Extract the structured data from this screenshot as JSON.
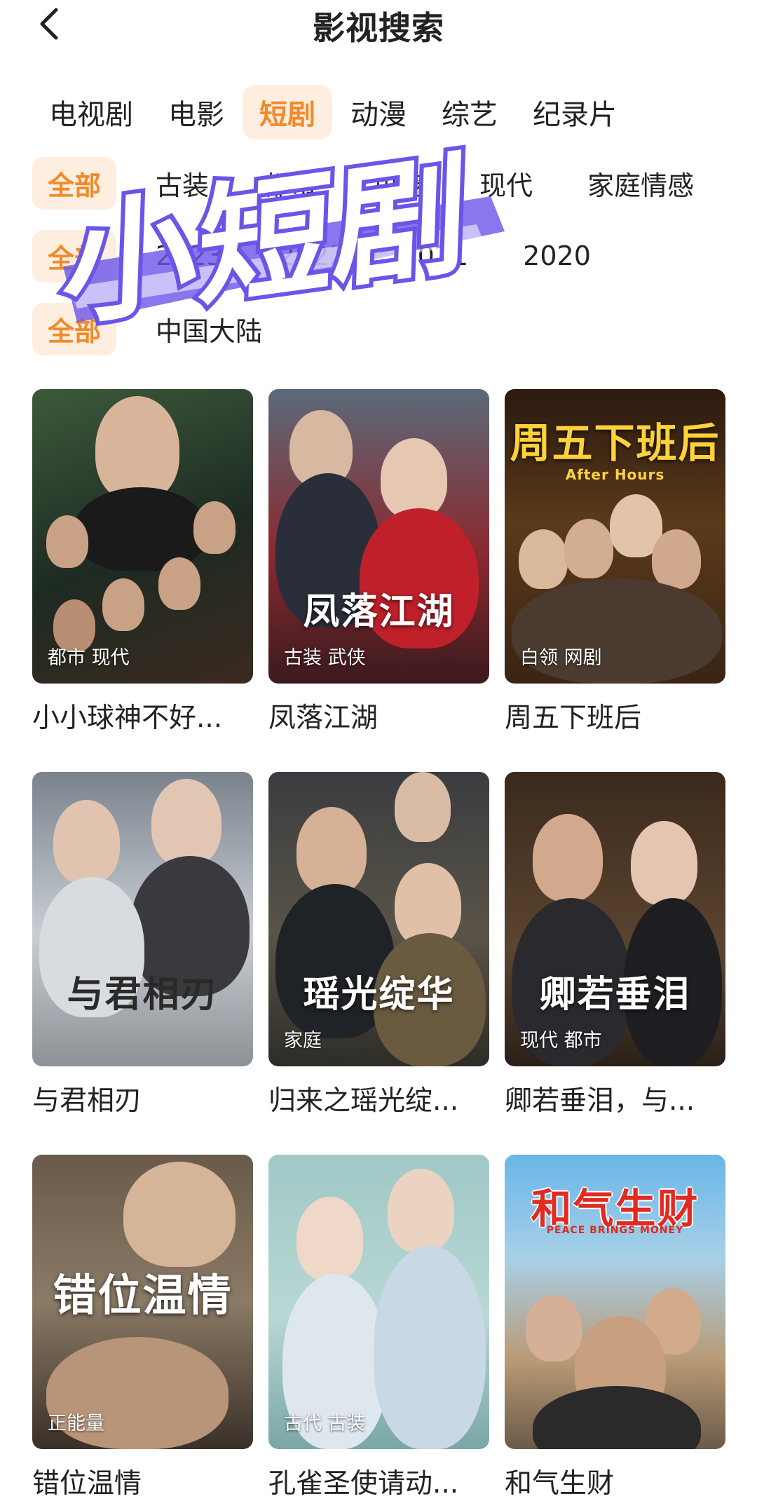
{
  "header": {
    "title": "影视搜索"
  },
  "category_tabs": [
    {
      "label": "电视剧",
      "active": false
    },
    {
      "label": "电影",
      "active": false
    },
    {
      "label": "短剧",
      "active": true
    },
    {
      "label": "动漫",
      "active": false
    },
    {
      "label": "综艺",
      "active": false
    },
    {
      "label": "纪录片",
      "active": false
    }
  ],
  "filters": {
    "genre": [
      "全部",
      "古装",
      "都市",
      "甜宠",
      "现代",
      "家庭情感"
    ],
    "year": [
      "全部",
      "2023",
      "2022",
      "2021",
      "2020"
    ],
    "region": [
      "全部",
      "中国大陆"
    ]
  },
  "overlay": {
    "text": "小短剧"
  },
  "items": [
    {
      "title": "小小球神不好...",
      "tags": "都市 现代",
      "poster_text": ""
    },
    {
      "title": "凤落江湖",
      "tags": "古装 武侠",
      "poster_text": "凤落江湖"
    },
    {
      "title": "周五下班后",
      "tags": "白领 网剧",
      "poster_text": "周五下班后",
      "poster_sub": "After Hours"
    },
    {
      "title": "与君相刃",
      "tags": "",
      "poster_text": "与君相刃"
    },
    {
      "title": "归来之瑶光绽...",
      "tags": "家庭",
      "poster_text": "瑶光绽华"
    },
    {
      "title": "卿若垂泪，与...",
      "tags": "现代 都市",
      "poster_text": "卿若垂泪"
    },
    {
      "title": "错位温情",
      "tags": "正能量",
      "poster_text": "错位温情"
    },
    {
      "title": "孔雀圣使请动...",
      "tags": "古代 古装",
      "poster_text": ""
    },
    {
      "title": "和气生财",
      "tags": "",
      "poster_text": "和气生财",
      "poster_sub": "PEACE BRINGS MONEY"
    }
  ],
  "colors": {
    "accent": "#f08a2a",
    "accent_bg": "#fdeee0",
    "overlay_purple": "#6a55e8"
  }
}
